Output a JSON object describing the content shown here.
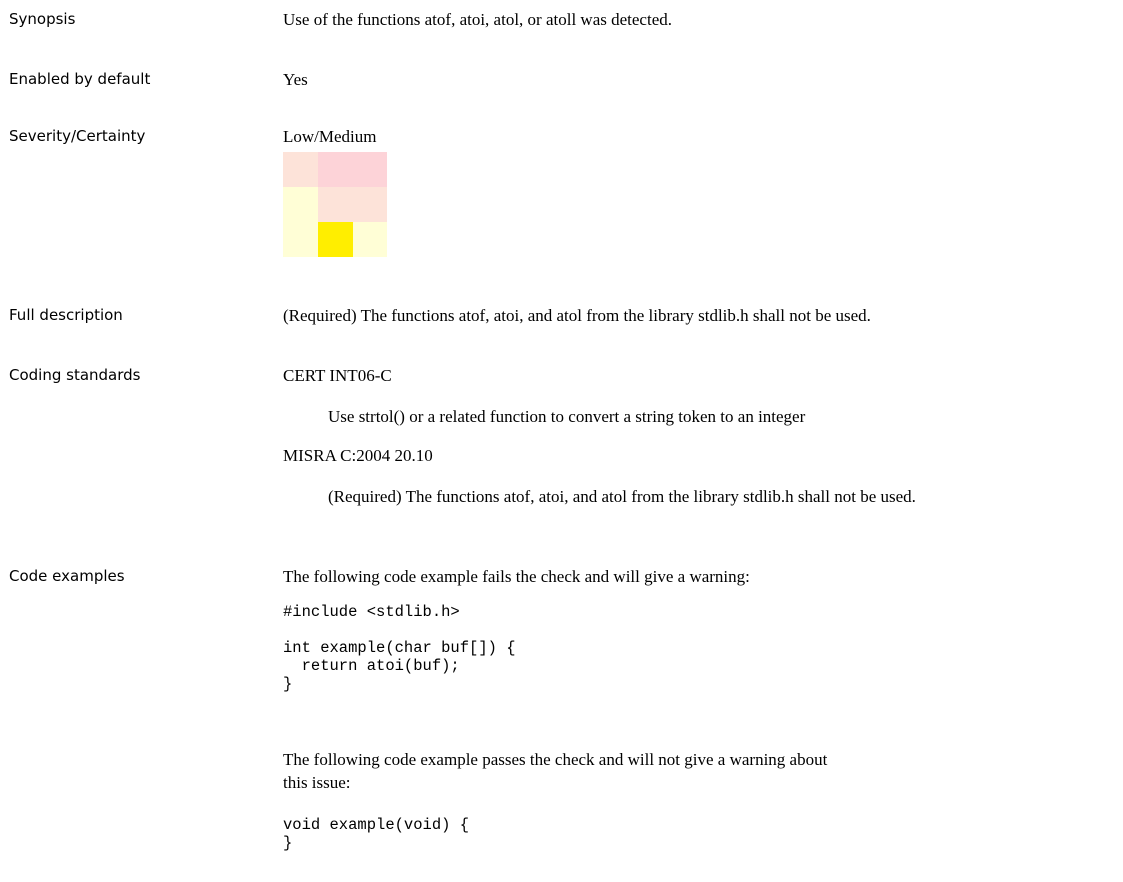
{
  "rows": {
    "synopsis": {
      "label": "Synopsis",
      "value": "Use of the functions atof, atoi, atol, or atoll was detected."
    },
    "enabled": {
      "label": "Enabled by default",
      "value": "Yes"
    },
    "severity": {
      "label": "Severity/Certainty",
      "value": "Low/Medium"
    },
    "full_description": {
      "label": "Full description",
      "value": "(Required) The functions atof, atoi, and atol from the library stdlib.h shall not be used."
    },
    "coding_standards": {
      "label": "Coding standards",
      "standards": [
        {
          "name": "CERT INT06-C",
          "text": "Use strtol() or a related function to convert a string token to an integer"
        },
        {
          "name": "MISRA C:2004 20.10",
          "text": "(Required) The functions atof, atoi, and atol from the library stdlib.h shall not be used."
        }
      ]
    },
    "code_examples": {
      "label": "Code examples",
      "fail_intro": "The following code example fails the check and will give a warning:",
      "fail_code": "#include <stdlib.h>\n\nint example(char buf[]) {\n  return atoi(buf);\n}",
      "pass_intro": "The following code example passes the check and will not give a warning about this issue:",
      "pass_code": "void example(void) {\n}"
    }
  },
  "severity_grid": {
    "selected": {
      "severity": "Low",
      "certainty": "Medium"
    },
    "colors": [
      [
        "#fde3d9",
        "#fdd3d8",
        "#fdd3d8"
      ],
      [
        "#fffed6",
        "#fde3d9",
        "#fde3d9"
      ],
      [
        "#fffed6",
        "#ffee00",
        "#fffed6"
      ]
    ]
  }
}
